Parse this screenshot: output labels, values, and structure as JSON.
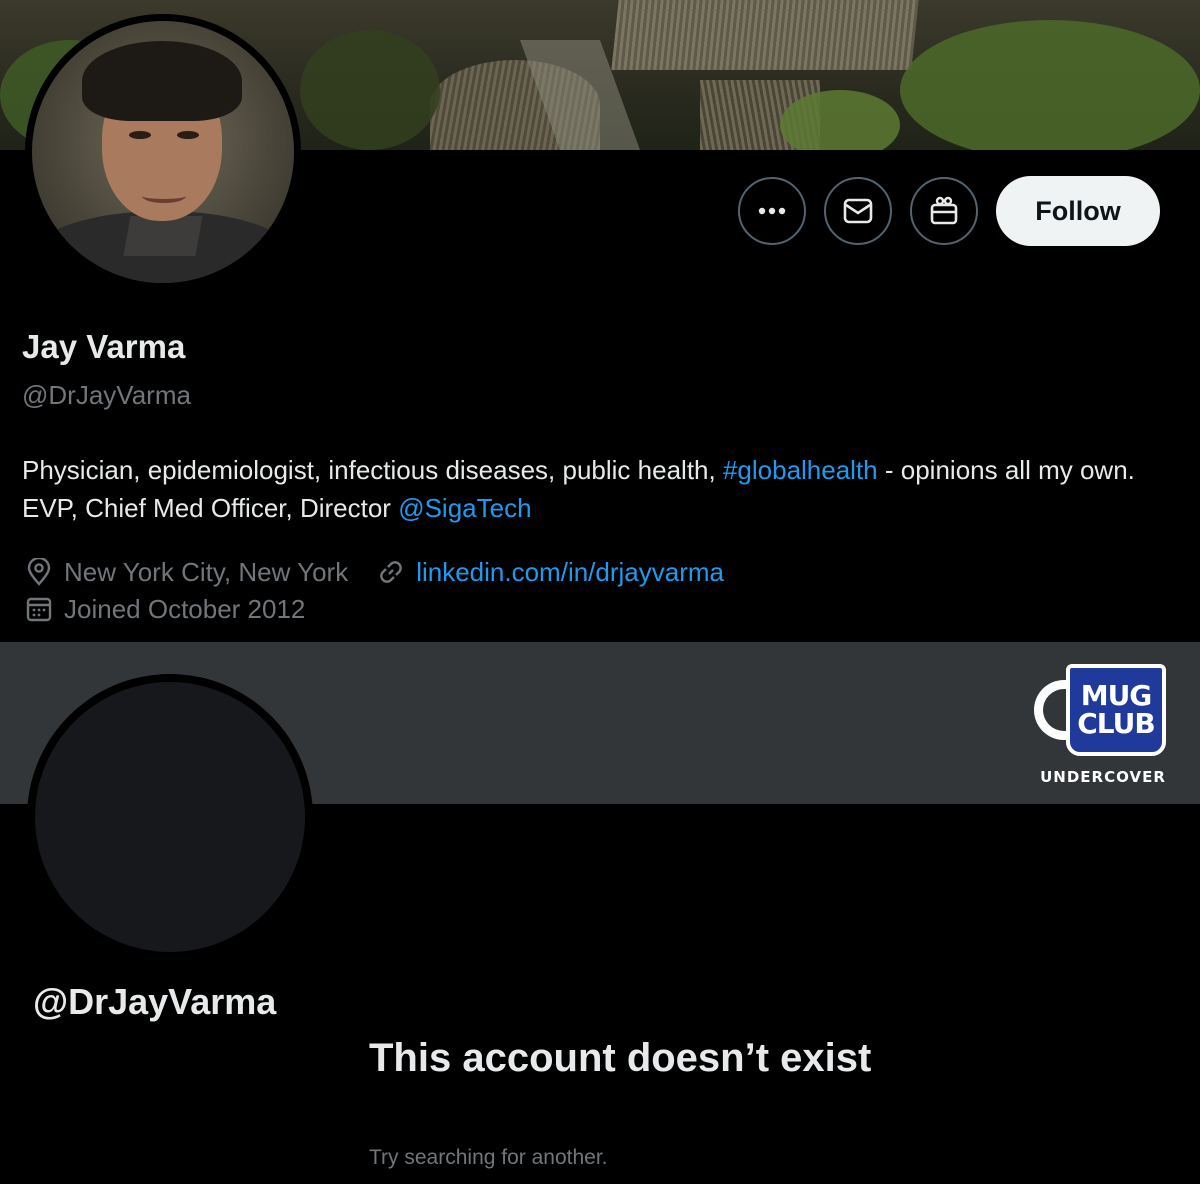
{
  "profile": {
    "name": "Jay Varma",
    "handle": "@DrJayVarma",
    "bio_text_1": "Physician, epidemiologist, infectious diseases, public health, ",
    "bio_hashtag": "#globalhealth",
    "bio_text_2": " - opinions all my own. EVP, Chief Med Officer, Director ",
    "bio_mention": "@SigaTech",
    "location": "New York City, New York",
    "website": "linkedin.com/in/drjayvarma",
    "joined": "Joined October 2012",
    "follow_label": "Follow",
    "icons": {
      "more": "more-icon",
      "message": "envelope-icon",
      "subscribe": "gift-icon",
      "location": "location-pin-icon",
      "link": "link-icon",
      "calendar": "calendar-icon"
    }
  },
  "deleted_profile": {
    "handle": "@DrJayVarma",
    "title": "This account doesn’t exist",
    "subtitle": "Try searching for another."
  },
  "watermark": {
    "line1": "MUG",
    "line2": "CLUB",
    "caption": "UNDERCOVER"
  },
  "colors": {
    "background": "#000000",
    "link": "#1d9bf0",
    "secondary_text": "#71767b",
    "banner_empty": "#333639",
    "logo_blue": "#1f3a9a"
  }
}
